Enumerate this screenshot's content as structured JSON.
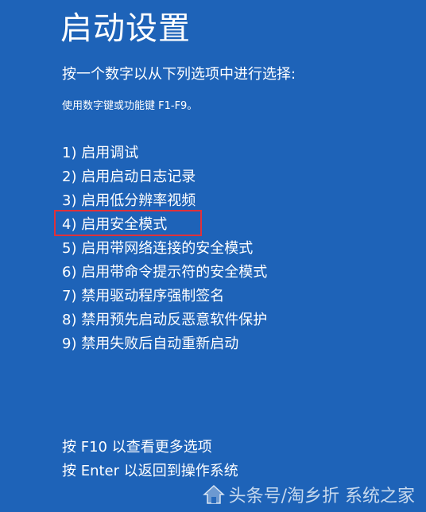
{
  "title": "启动设置",
  "prompt": "按一个数字以从下列选项中进行选择:",
  "hint": "使用数字键或功能键 F1-F9。",
  "options": [
    {
      "label": "1) 启用调试"
    },
    {
      "label": "2) 启用启动日志记录"
    },
    {
      "label": "3) 启用低分辨率视频"
    },
    {
      "label": "4) 启用安全模式",
      "highlighted": true
    },
    {
      "label": "5) 启用带网络连接的安全模式"
    },
    {
      "label": "6) 启用带命令提示符的安全模式"
    },
    {
      "label": "7) 禁用驱动程序强制签名"
    },
    {
      "label": "8) 禁用预先启动反恶意软件保护"
    },
    {
      "label": "9) 禁用失败后自动重新启动"
    }
  ],
  "footer": {
    "more_options": "按 F10 以查看更多选项",
    "return_os": "按 Enter 以返回到操作系统"
  },
  "watermark": {
    "text": "头条号/淘乡折  系统之家",
    "icon": "house-logo-icon"
  },
  "colors": {
    "background": "#1E63B8",
    "text": "#FFFFFF",
    "highlight_border": "#E0313A"
  }
}
